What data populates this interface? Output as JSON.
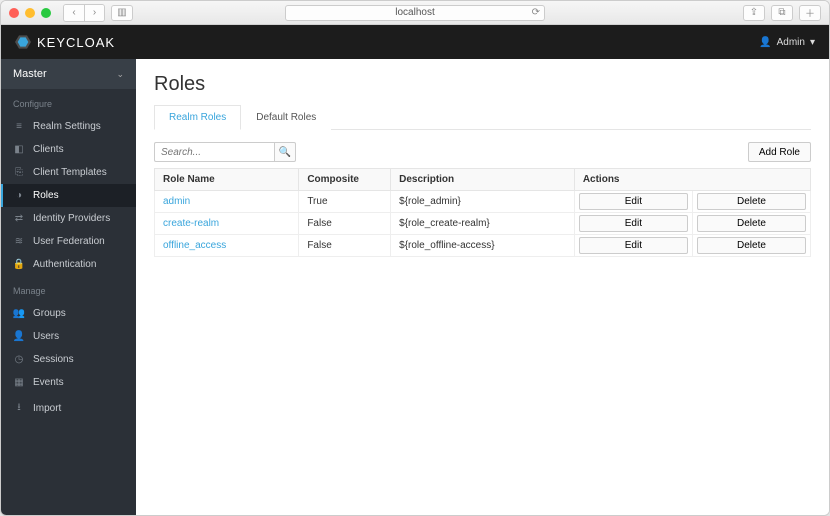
{
  "browser": {
    "url": "localhost"
  },
  "header": {
    "brand": "KEYCLOAK",
    "user_label": "Admin"
  },
  "sidebar": {
    "realm": "Master",
    "sections": [
      {
        "title": "Configure",
        "items": [
          {
            "icon": "sliders",
            "label": "Realm Settings"
          },
          {
            "icon": "tag",
            "label": "Clients"
          },
          {
            "icon": "copy",
            "label": "Client Templates"
          },
          {
            "icon": "bookmark",
            "label": "Roles",
            "active": true
          },
          {
            "icon": "exchange",
            "label": "Identity Providers"
          },
          {
            "icon": "db",
            "label": "User Federation"
          },
          {
            "icon": "lock",
            "label": "Authentication"
          }
        ]
      },
      {
        "title": "Manage",
        "items": [
          {
            "icon": "group",
            "label": "Groups"
          },
          {
            "icon": "user",
            "label": "Users"
          },
          {
            "icon": "clock",
            "label": "Sessions"
          },
          {
            "icon": "calendar",
            "label": "Events"
          },
          {
            "icon": "download",
            "label": "Import"
          }
        ]
      }
    ]
  },
  "page": {
    "title": "Roles",
    "tabs": [
      "Realm Roles",
      "Default Roles"
    ],
    "active_tab": 0,
    "search_placeholder": "Search...",
    "add_button": "Add Role",
    "columns": [
      "Role Name",
      "Composite",
      "Description",
      "Actions"
    ],
    "rows": [
      {
        "name": "admin",
        "composite": "True",
        "description": "${role_admin}"
      },
      {
        "name": "create-realm",
        "composite": "False",
        "description": "${role_create-realm}"
      },
      {
        "name": "offline_access",
        "composite": "False",
        "description": "${role_offline-access}"
      }
    ],
    "edit_label": "Edit",
    "delete_label": "Delete"
  }
}
